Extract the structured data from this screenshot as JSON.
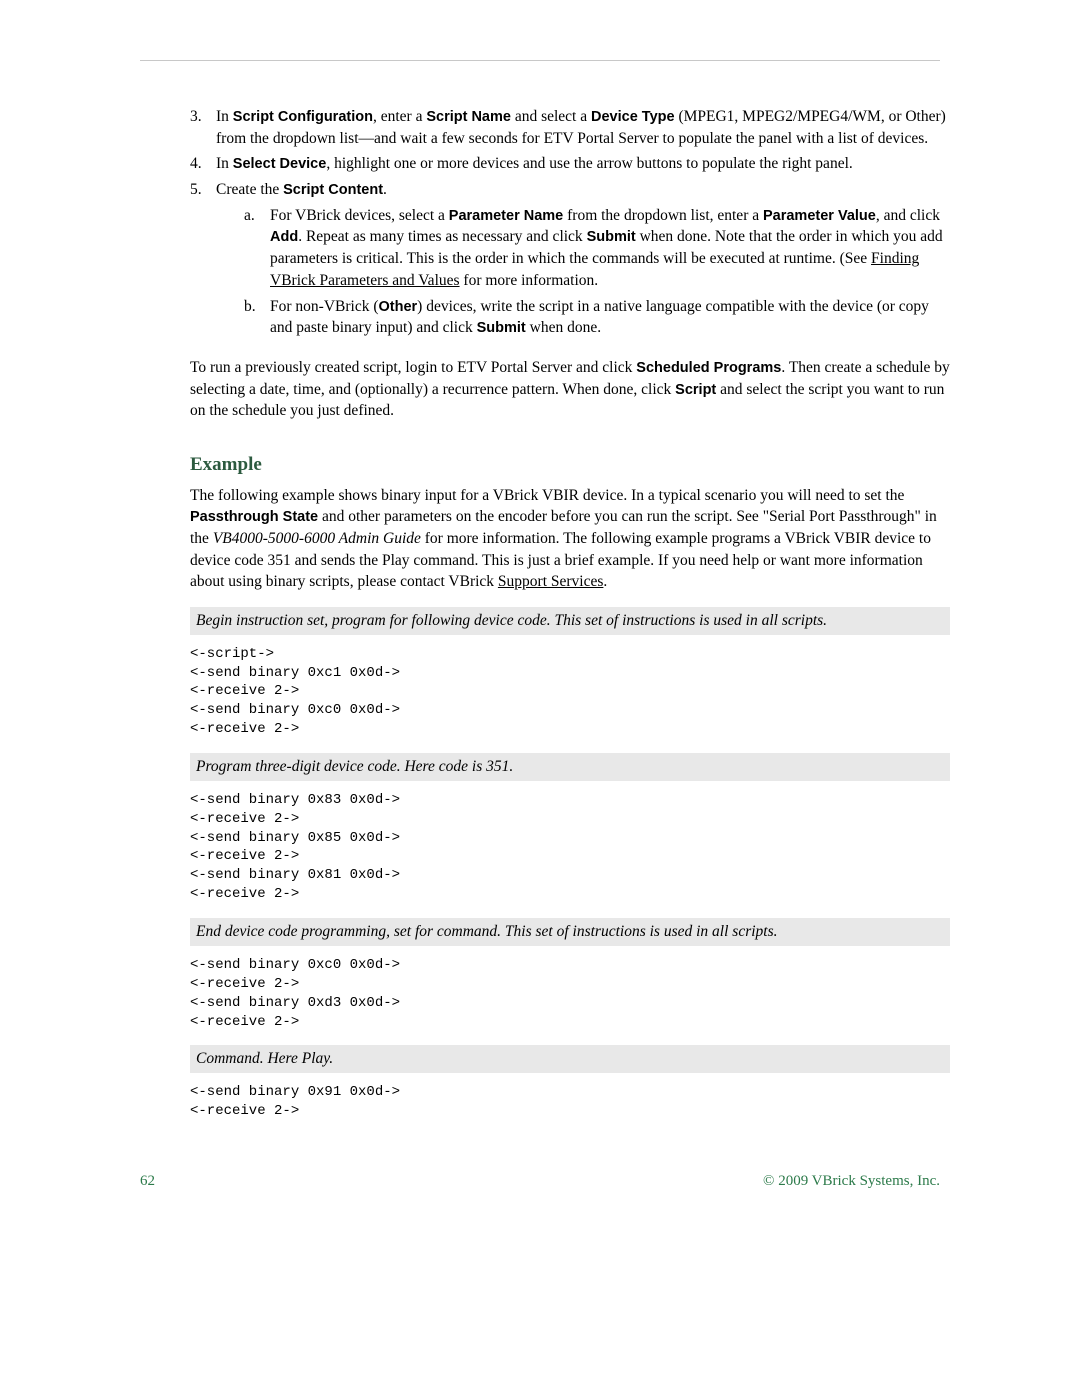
{
  "steps": {
    "s3": {
      "num": "3.",
      "pre1": "In ",
      "b1": "Script Configuration",
      "mid1": ", enter a ",
      "b2": "Script Name",
      "mid2": " and select a ",
      "b3": "Device Type",
      "post": " (MPEG1, MPEG2/MPEG4/WM, or Other) from the dropdown list—and wait a few seconds for ETV Portal Server to populate the panel with a list of devices."
    },
    "s4": {
      "num": "4.",
      "pre1": "In ",
      "b1": "Select Device",
      "post": ", highlight one or more devices and use the arrow buttons to populate the right panel."
    },
    "s5": {
      "num": "5.",
      "pre1": "Create the ",
      "b1": "Script Content",
      "post": ".",
      "a": {
        "num": "a.",
        "pre1": "For VBrick devices, select a ",
        "b1": "Parameter Name",
        "mid1": " from the dropdown list, enter a ",
        "b2": "Parameter Value",
        "mid2": ", and click ",
        "b3": "Add",
        "mid3": ". Repeat as many times as necessary and click ",
        "b4": "Submit",
        "mid4": " when done. Note that the order in which you add parameters is critical. This is the order in which the commands will be executed at runtime. (See ",
        "link": "Finding VBrick Parameters and Values",
        "post": " for more information."
      },
      "b": {
        "num": "b.",
        "pre1": "For non-VBrick (",
        "b1": "Other",
        "mid1": ") devices, write the script in a native language compatible with the device (or copy and paste binary input) and click ",
        "b2": "Submit",
        "post": " when done."
      }
    }
  },
  "run_para": {
    "pre1": "To run a previously created script, login to ETV Portal Server and click ",
    "b1": "Scheduled Programs",
    "mid1": ". Then create a schedule by selecting a date, time, and (optionally) a recurrence pattern. When done, click ",
    "b2": "Script",
    "post": " and select the script you want to run on the schedule you just defined."
  },
  "example_heading": "Example",
  "example_para": {
    "pre1": "The following example shows binary input for a VBrick VBIR device. In a typical scenario you will need to set the ",
    "b1": "Passthrough State",
    "mid1": " and other parameters on the encoder before you can run the script. See \"Serial Port Passthrough\" in the ",
    "i1": "VB4000-5000-6000 Admin Guide",
    "mid2": " for more information. The following example programs a VBrick VBIR device to device code 351 and sends the Play command. This is just a brief example. If you need help or want more information about using binary scripts, please contact VBrick ",
    "link": "Support Services",
    "post": "."
  },
  "bar1": "Begin instruction set, program for following device code. This set of instructions is used in all scripts.",
  "code1": "<-script->\n<-send binary 0xc1 0x0d->\n<-receive 2->\n<-send binary 0xc0 0x0d->\n<-receive 2->",
  "bar2": "Program three-digit device code. Here code is 351.",
  "code2": "<-send binary 0x83 0x0d->\n<-receive 2->\n<-send binary 0x85 0x0d->\n<-receive 2->\n<-send binary 0x81 0x0d->\n<-receive 2->",
  "bar3": "End device code programming, set for command. This set of instructions is used in all scripts.",
  "code3": "<-send binary 0xc0 0x0d->\n<-receive 2->\n<-send binary 0xd3 0x0d->\n<-receive 2->",
  "bar4": "Command. Here Play.",
  "code4": "<-send binary 0x91 0x0d->\n<-receive 2->",
  "footer": {
    "page": "62",
    "copyright": "© 2009 VBrick Systems, Inc."
  }
}
